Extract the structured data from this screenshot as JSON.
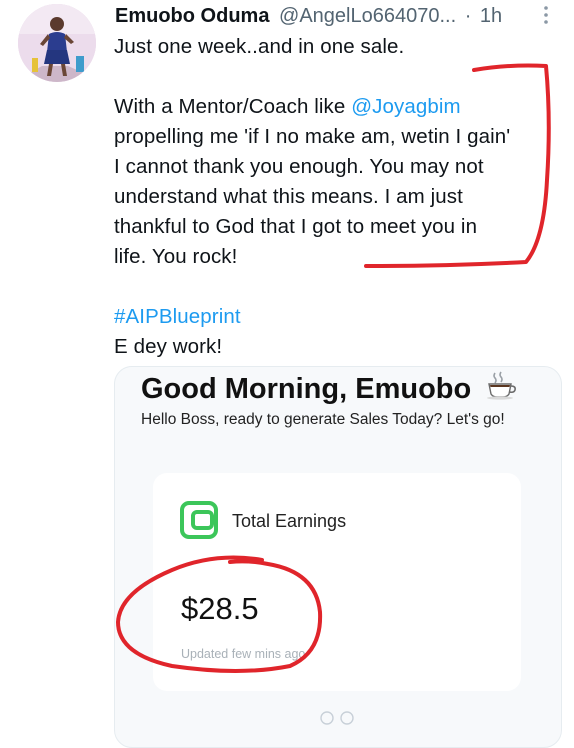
{
  "tweet": {
    "author_name": "Emuobo Oduma",
    "author_handle": "@AngelLo664070...",
    "separator": "·",
    "time": "1h",
    "lines": [
      "Just one week..and in one sale.",
      "",
      "With a Mentor/Coach like @Joyagbim",
      "propelling me 'if I no make am, wetin I gain'",
      "I cannot thank you enough. You may not",
      "understand what this means. I am just",
      "thankful to God that I got to meet you in",
      "life. You rock!",
      "",
      "#AIPBlueprint",
      "E dey work!"
    ],
    "mention_prefix": "With a Mentor/Coach like ",
    "mention": "@Joyagbim",
    "hashtag": "#AIPBlueprint",
    "link_color": "#1d9bf0"
  },
  "media": {
    "greeting": "Good Morning, Emuobo",
    "greeting_icon": "coffee-cup-icon",
    "subtitle": "Hello Boss, ready to generate Sales Today? Let's go!",
    "earnings_icon": "wallet-icon",
    "earnings_label": "Total Earnings",
    "earnings_amount": "$28.5",
    "updated_text": "Updated few mins ago",
    "accent_color": "#3cc65a"
  },
  "annotations": {
    "color": "#e0252b",
    "shapes": [
      "bracket",
      "circle"
    ]
  }
}
